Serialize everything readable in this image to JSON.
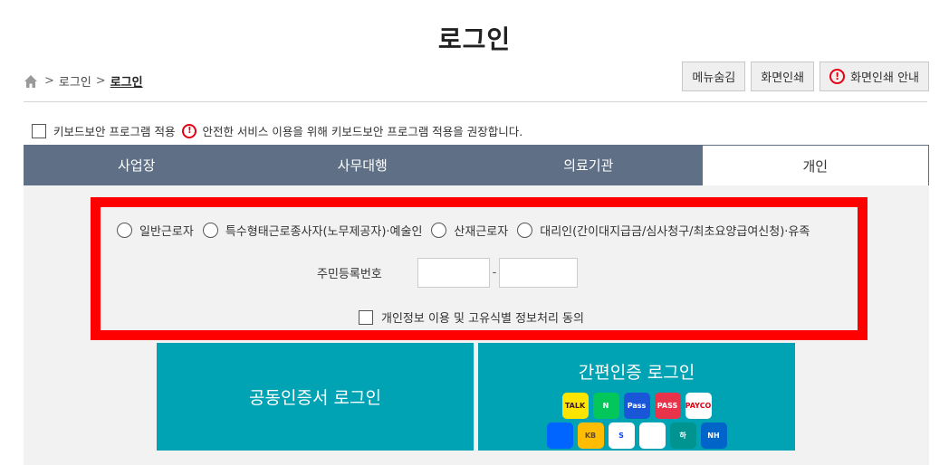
{
  "page": {
    "title": "로그인"
  },
  "breadcrumb": {
    "items": [
      "로그인",
      "로그인"
    ],
    "separator": ">"
  },
  "toolbar": {
    "menu_hide_label": "메뉴숨김",
    "print_label": "화면인쇄",
    "print_guide_label": "화면인쇄 안내",
    "warn_glyph": "!"
  },
  "keyboard_security": {
    "label": "키보드보안 프로그램 적용",
    "notice": "안전한 서비스 이용을 위해 키보드보안 프로그램 적용을 권장합니다."
  },
  "tabs": [
    {
      "label": "사업장",
      "active": false
    },
    {
      "label": "사무대행",
      "active": false
    },
    {
      "label": "의료기관",
      "active": false
    },
    {
      "label": "개인",
      "active": true
    }
  ],
  "form": {
    "user_types": [
      "일반근로자",
      "특수형태근로종사자(노무제공자)·예술인",
      "산재근로자",
      "대리인(간이대지급금/심사청구/최초요양급여신청)·유족"
    ],
    "resident_number_label": "주민등록번호",
    "resident_number_separator": "-",
    "consent_label": "개인정보 이용 및 고유식별 정보처리 동의"
  },
  "login": {
    "certificate_label": "공동인증서 로그인",
    "simple_auth_label": "간편인증 로그인",
    "providers_row1": [
      {
        "icon": "kakao-talk-icon",
        "text": "TALK",
        "bg": "#fee500",
        "fg": "#3c1e1e"
      },
      {
        "icon": "naver-icon",
        "text": "N",
        "bg": "#03c75a",
        "fg": "#ffffff"
      },
      {
        "icon": "samsung-pass-icon",
        "text": "Pass",
        "bg": "#1a57d8",
        "fg": "#ffffff"
      },
      {
        "icon": "pass-icon",
        "text": "PASS",
        "bg": "#e8334a",
        "fg": "#ffffff"
      },
      {
        "icon": "payco-icon",
        "text": "PAYCO",
        "bg": "#ffffff",
        "fg": "#e60012"
      }
    ],
    "providers_row2": [
      {
        "icon": "toss-icon",
        "text": "",
        "bg": "#0064ff",
        "fg": "#ffffff"
      },
      {
        "icon": "kb-bank-icon",
        "text": "KB",
        "bg": "#ffbc00",
        "fg": "#5a4a3a"
      },
      {
        "icon": "shinhan-bank-icon",
        "text": "S",
        "bg": "#ffffff",
        "fg": "#0046ff"
      },
      {
        "icon": "woori-icon",
        "text": "",
        "bg": "#ffffff",
        "fg": "#00b37e"
      },
      {
        "icon": "hana-bank-icon",
        "text": "하",
        "bg": "#009490",
        "fg": "#ffffff"
      },
      {
        "icon": "nh-bank-icon",
        "text": "NH",
        "bg": "#0064c8",
        "fg": "#ffffff"
      }
    ]
  },
  "colors": {
    "tab_bg": "#5f6f85",
    "accent_teal": "#00a3b3",
    "highlight_red": "#ff0000",
    "warn_red": "#e60012"
  }
}
